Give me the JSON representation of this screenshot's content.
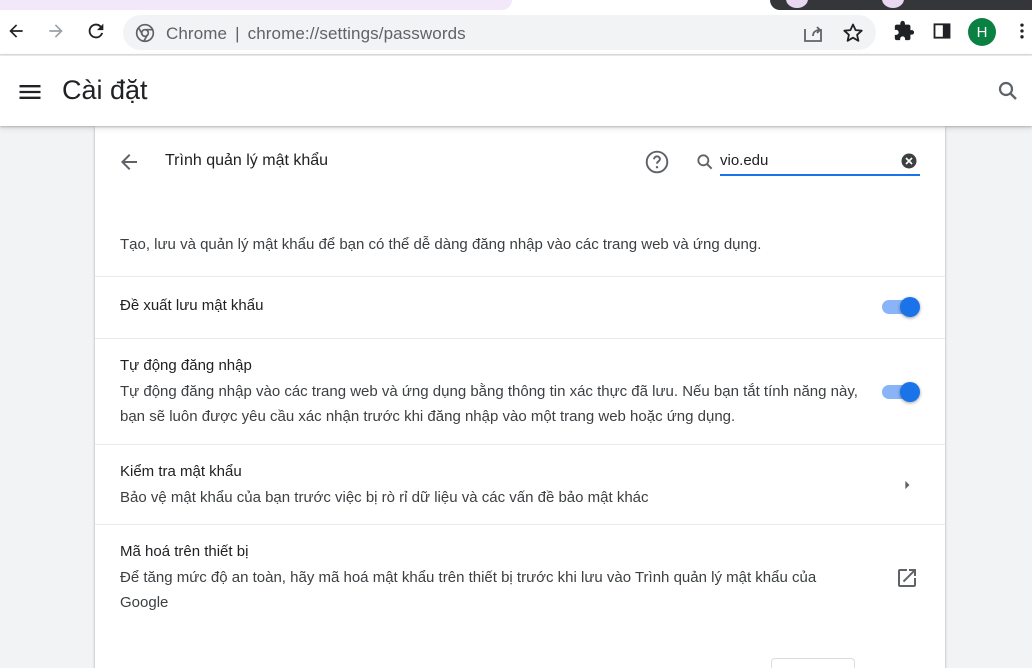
{
  "browser": {
    "omnibox": {
      "site_label": "Chrome",
      "separator": "|",
      "url": "chrome://settings/passwords"
    },
    "profile_initial": "H",
    "profile_color": "#0b8043"
  },
  "header": {
    "title": "Cài đặt"
  },
  "password_manager": {
    "title": "Trình quản lý mật khẩu",
    "search_value": "vio.edu",
    "description": "Tạo, lưu và quản lý mật khẩu để bạn có thể dễ dàng đăng nhập vào các trang web và ứng dụng.",
    "rows": [
      {
        "title": "Đề xuất lưu mật khẩu",
        "toggle_on": true
      },
      {
        "title": "Tự động đăng nhập",
        "subtitle": "Tự động đăng nhập vào các trang web và ứng dụng bằng thông tin xác thực đã lưu. Nếu bạn tắt tính năng này, bạn sẽ luôn được yêu cầu xác nhận trước khi đăng nhập vào một trang web hoặc ứng dụng.",
        "toggle_on": true
      },
      {
        "title": "Kiểm tra mật khẩu",
        "subtitle": "Bảo vệ mật khẩu của bạn trước việc bị rò rỉ dữ liệu và các vấn đề bảo mật khác"
      },
      {
        "title": "Mã hoá trên thiết bị",
        "subtitle": "Để tăng mức độ an toàn, hãy mã hoá mật khẩu trên thiết bị trước khi lưu vào Trình quản lý mật khẩu của Google"
      }
    ]
  },
  "colors": {
    "accent": "#1a73e8",
    "toggle_track": "#8ab4f8"
  }
}
